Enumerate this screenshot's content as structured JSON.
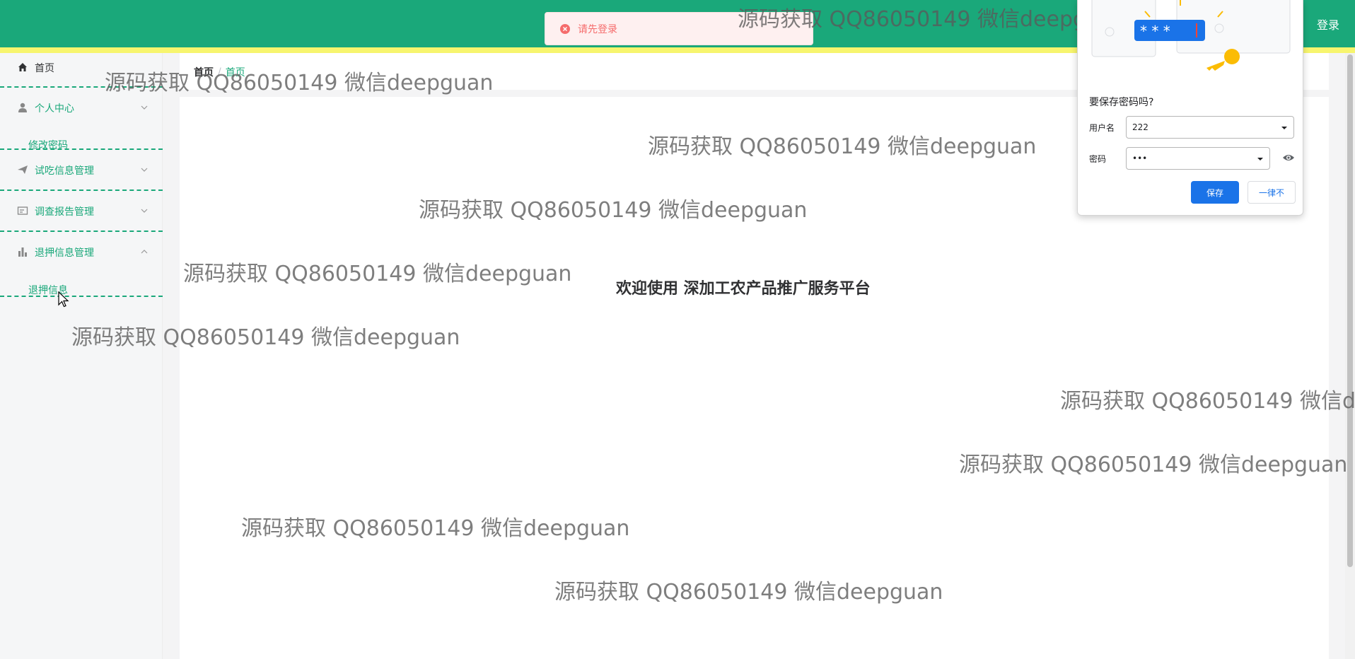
{
  "topbar": {
    "login_label": "登录",
    "color": "#1aa87a",
    "stripe_color": "#f7f56e"
  },
  "toast": {
    "message": "请先登录",
    "icon": "error-circle-icon"
  },
  "sidebar": {
    "home_label": "首页",
    "items": [
      {
        "label": "个人中心",
        "icon": "user-icon",
        "expanded": false
      },
      {
        "label": "试吃信息管理",
        "icon": "paper-plane-icon",
        "expanded": false
      },
      {
        "label": "调查报告管理",
        "icon": "id-card-icon",
        "expanded": false
      },
      {
        "label": "退押信息管理",
        "icon": "bar-chart-icon",
        "expanded": true
      }
    ],
    "sub_items": {
      "personal": "修改密码",
      "refund": "退押信息"
    }
  },
  "breadcrumb": {
    "root": "首页",
    "separator": "/",
    "current": "首页"
  },
  "main": {
    "welcome": "欢迎使用 深加工农产品推广服务平台"
  },
  "watermark": {
    "text": "源码获取 QQ86050149 微信deepguan",
    "text_cut": "源码获取 QQ86050149 微信de"
  },
  "password_dialog": {
    "title": "要保存密码吗?",
    "username_label": "用户名",
    "username_value": "222",
    "password_label": "密码",
    "password_value": "•••",
    "save_label": "保存",
    "never_label": "一律不",
    "illustration_mask": "* * *",
    "accent": "#1a73e8"
  }
}
